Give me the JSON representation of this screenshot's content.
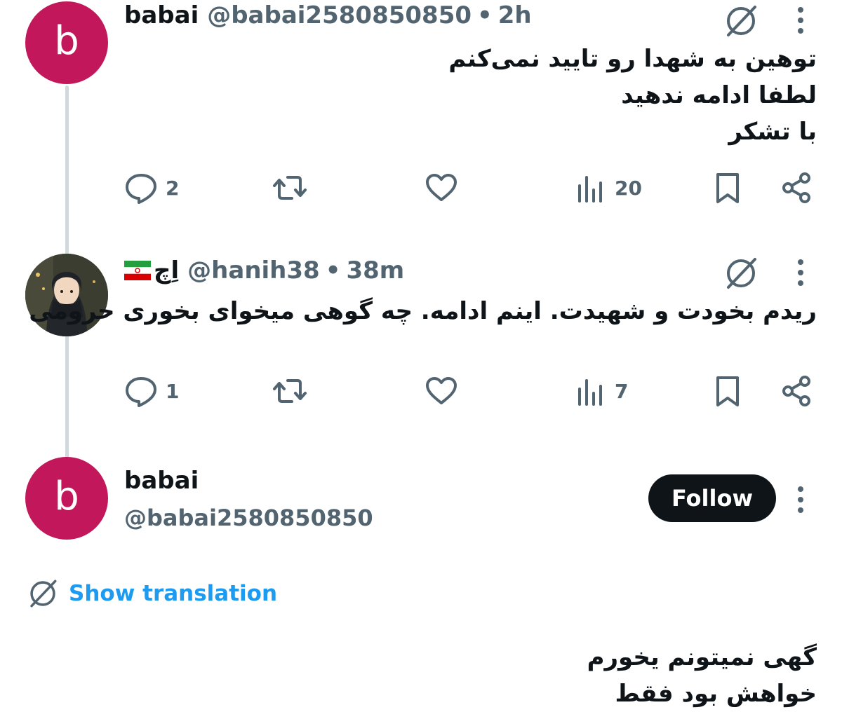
{
  "thread": {
    "tweet1": {
      "avatar_letter": "b",
      "avatar_color": "#c2185b",
      "display_name": "babai",
      "handle": "@babai2580850850",
      "time": "2h",
      "body_lines": [
        "توهین به شهدا رو تایید نمی‌کنم",
        "لطفا ادامه ندهید",
        "با تشکر"
      ],
      "replies": "2",
      "views": "20"
    },
    "tweet2": {
      "display_name": "اِچ",
      "handle": "@hanih38",
      "time": "38m",
      "body_lines": [
        "ریدم بخودت و شهیدت. اینم ادامه. چه گوهی میخوای بخوری حرومی"
      ],
      "replies": "1",
      "views": "7"
    }
  },
  "main_tweet": {
    "avatar_letter": "b",
    "display_name": "babai",
    "handle": "@babai2580850850",
    "follow_label": "Follow",
    "translation_label": "Show translation",
    "body_lines": [
      "گهی نمیتونم یخورم",
      "خواهش بود فقط"
    ]
  },
  "icons": {
    "reply": "reply-icon",
    "retweet": "retweet-icon",
    "like": "heart-icon",
    "views": "views-icon",
    "bookmark": "bookmark-icon",
    "share": "share-icon",
    "grok": "grok-icon",
    "more": "more-vertical-icon"
  },
  "colors": {
    "text": "#0f1419",
    "secondary": "#536471",
    "link": "#1d9bf0",
    "thread_line": "#cfd9de"
  }
}
